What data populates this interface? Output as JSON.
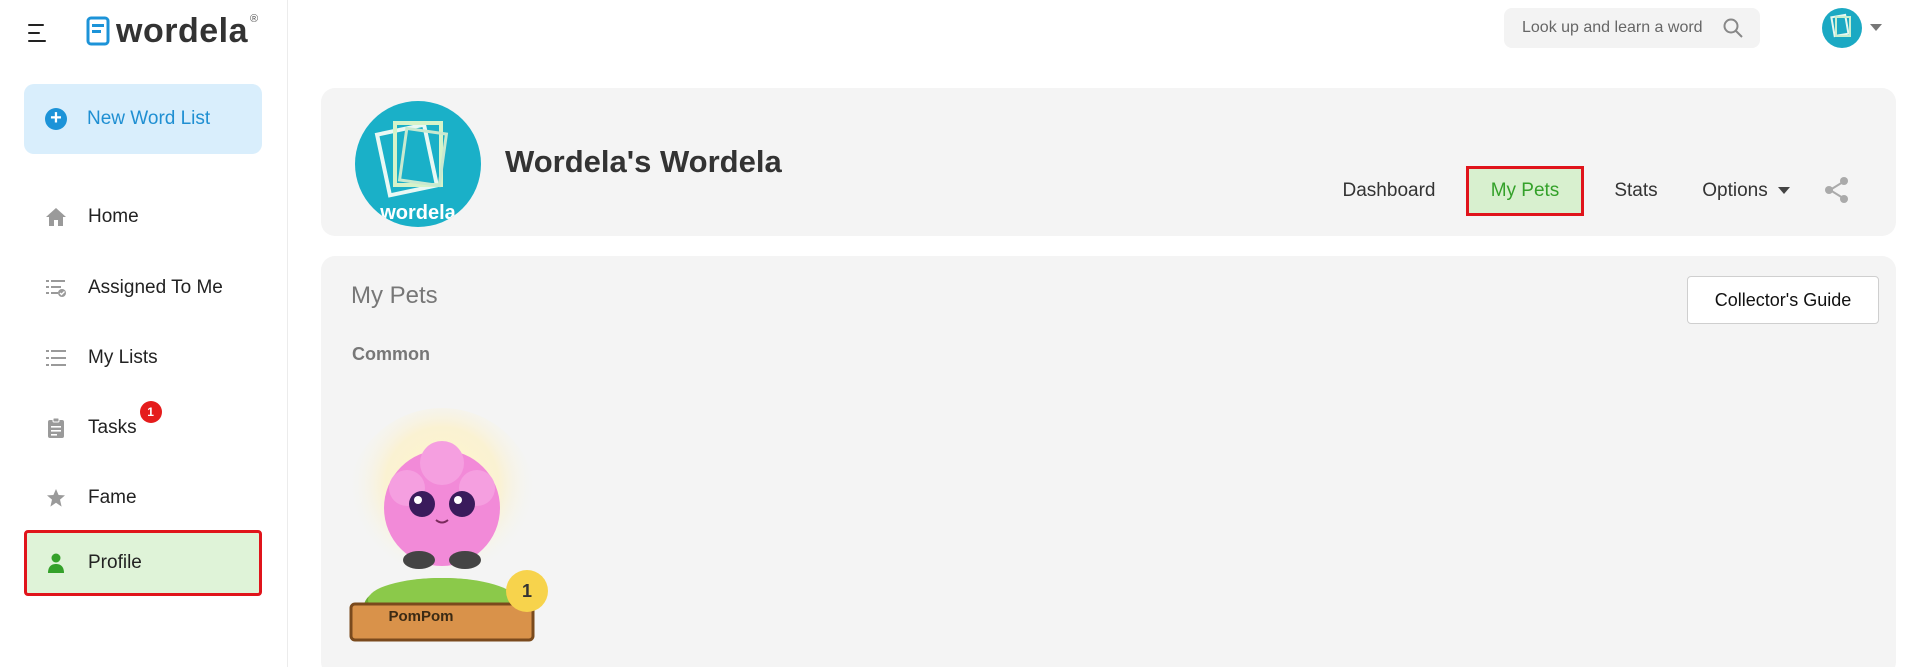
{
  "app": {
    "logo_text": "wordela",
    "logo_reg": "®"
  },
  "sidebar": {
    "new_list_label": "New Word List",
    "items": [
      {
        "label": "Home",
        "icon": "home-icon"
      },
      {
        "label": "Assigned To Me",
        "icon": "assigned-list-icon"
      },
      {
        "label": "My Lists",
        "icon": "list-icon"
      },
      {
        "label": "Tasks",
        "icon": "clipboard-icon",
        "badge": "1"
      },
      {
        "label": "Fame",
        "icon": "star-icon"
      },
      {
        "label": "Profile",
        "icon": "person-icon",
        "active": true
      }
    ]
  },
  "topbar": {
    "search_placeholder": "Look up and learn a word"
  },
  "profile": {
    "name": "Wordela's Wordela",
    "avatar_text": "wordela",
    "tabs": [
      {
        "label": "Dashboard"
      },
      {
        "label": "My Pets",
        "active": true
      },
      {
        "label": "Stats"
      },
      {
        "label": "Options"
      }
    ]
  },
  "pets": {
    "title": "My Pets",
    "collector_button": "Collector's Guide",
    "section": "Common",
    "items": [
      {
        "name": "PomPom",
        "count": "1"
      }
    ]
  },
  "colors": {
    "accent_blue": "#1c93d8",
    "active_green": "#34a12a",
    "highlight_red": "#e0141b",
    "badge_red": "#e51c1c"
  }
}
